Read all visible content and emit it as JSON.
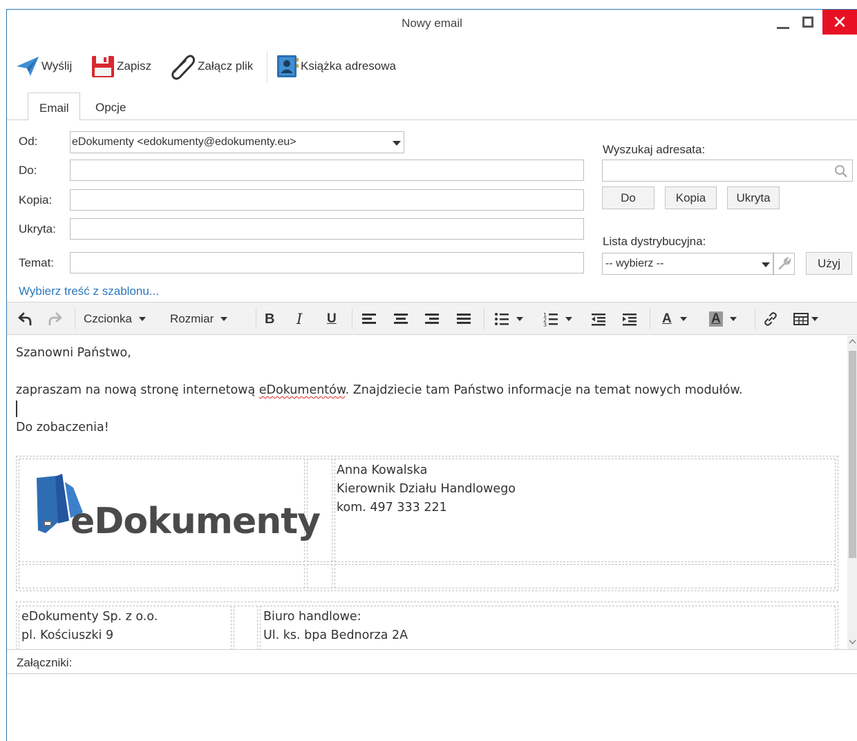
{
  "window": {
    "title": "Nowy email"
  },
  "toolbar": {
    "send": "Wyślij",
    "save": "Zapisz",
    "attach": "Załącz plik",
    "address_book": "Książka adresowa"
  },
  "tabs": [
    {
      "label": "Email"
    },
    {
      "label": "Opcje"
    }
  ],
  "form": {
    "from_label": "Od:",
    "from_value": "eDokumenty <edokumenty@edokumenty.eu>",
    "to_label": "Do:",
    "cc_label": "Kopia:",
    "bcc_label": "Ukryta:",
    "subject_label": "Temat:",
    "template_link": "Wybierz treść z szablonu..."
  },
  "side": {
    "search_label": "Wyszukaj adresata:",
    "btn_to": "Do",
    "btn_cc": "Kopia",
    "btn_bcc": "Ukryta",
    "dist_label": "Lista dystrybucyjna:",
    "dist_value": "-- wybierz --",
    "btn_use": "Użyj"
  },
  "editor_toolbar": {
    "font": "Czcionka",
    "size": "Rozmiar"
  },
  "body": {
    "greeting": "Szanowni Państwo,",
    "line1_a": "zapraszam na nową stronę internetową ",
    "line1_b": "eDokumentów",
    "line1_c": ". Znajdziecie tam Państwo informacje na temat nowych modułów.",
    "closing": "Do zobaczenia!"
  },
  "signature": {
    "logo": "eDokumenty",
    "name": "Anna Kowalska",
    "position": "Kierownik Działu Handlowego",
    "phone": "kom. 497 333 221",
    "company": "eDokumenty Sp. z o.o.",
    "address": "pl. Kościuszki 9",
    "office_label": "Biuro handlowe:",
    "office_address": "Ul. ks. bpa Bednorza 2A"
  },
  "attachments": {
    "label": "Załączniki:"
  },
  "colors": {
    "accent": "#2f78b5",
    "close": "#e81123",
    "link": "#2a78bf"
  }
}
